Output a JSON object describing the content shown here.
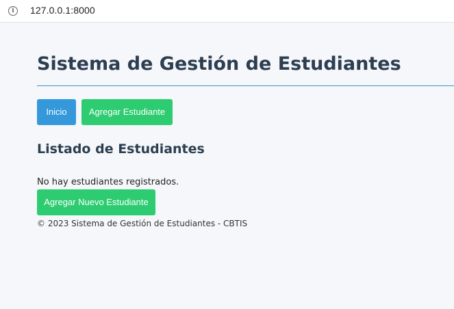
{
  "browser": {
    "url": "127.0.0.1:8000",
    "info_icon": "i"
  },
  "header": {
    "title": "Sistema de Gestión de Estudiantes"
  },
  "nav": {
    "inicio_label": "Inicio",
    "agregar_label": "Agregar Estudiante"
  },
  "main": {
    "section_title": "Listado de Estudiantes",
    "empty_message": "No hay estudiantes registrados.",
    "add_new_label": "Agregar Nuevo Estudiante"
  },
  "footer": {
    "text": "© 2023 Sistema de Gestión de Estudiantes - CBTIS"
  },
  "colors": {
    "primary_blue": "#3498db",
    "success_green": "#2ecc71",
    "heading": "#2c3e50",
    "rule": "#3d8fd1"
  }
}
